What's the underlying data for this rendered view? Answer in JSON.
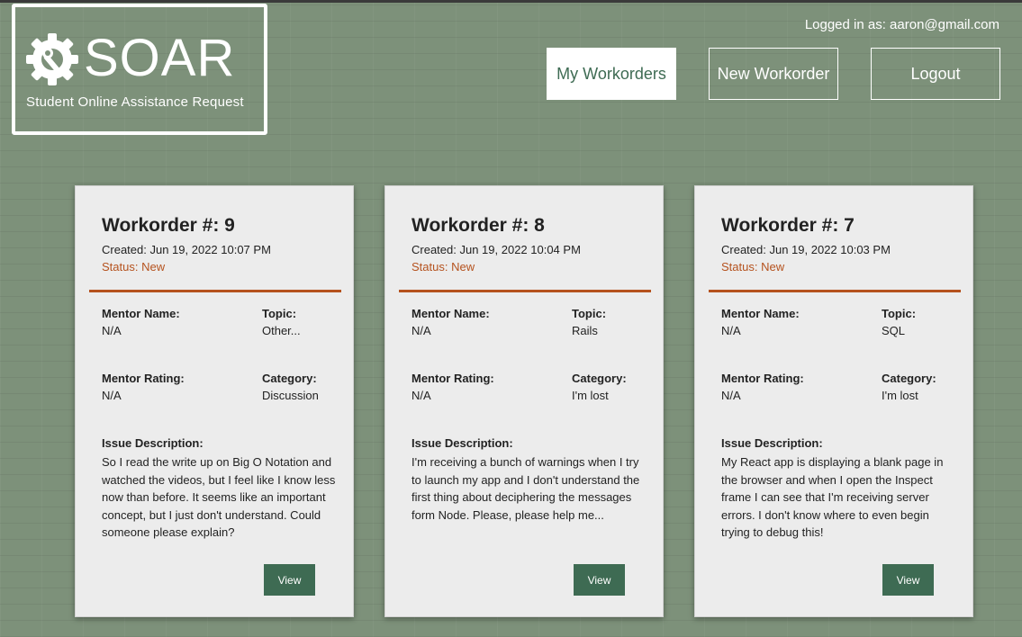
{
  "header": {
    "logo_text": "SOAR",
    "logo_subtitle": "Student Online Assistance Request",
    "logged_in_text": "Logged in as: aaron@gmail.com",
    "nav": {
      "my_workorders": "My Workorders",
      "new_workorder": "New Workorder",
      "logout": "Logout"
    }
  },
  "labels": {
    "mentor_name": "Mentor Name:",
    "topic": "Topic:",
    "mentor_rating": "Mentor Rating:",
    "category": "Category:",
    "issue_description": "Issue Description:",
    "view": "View"
  },
  "colors": {
    "accent": "#b5521e",
    "button_green": "#3e6b53",
    "background": "#7d917a"
  },
  "cards": [
    {
      "title": "Workorder #: 9",
      "created": "Created: Jun 19, 2022 10:07 PM",
      "status": "Status: New",
      "mentor_name": "N/A",
      "topic": "Other...",
      "mentor_rating": "N/A",
      "category": "Discussion",
      "description": "So I read the write up on Big O Notation and watched the videos, but I feel like I know less now than before. It seems like an important concept, but I just don't understand. Could someone please explain?"
    },
    {
      "title": "Workorder #: 8",
      "created": "Created: Jun 19, 2022 10:04 PM",
      "status": "Status: New",
      "mentor_name": "N/A",
      "topic": "Rails",
      "mentor_rating": "N/A",
      "category": "I'm lost",
      "description": "I'm receiving a bunch of warnings when I try to launch my app and I don't understand the first thing about deciphering the messages form Node. Please, please help me..."
    },
    {
      "title": "Workorder #: 7",
      "created": "Created: Jun 19, 2022 10:03 PM",
      "status": "Status: New",
      "mentor_name": "N/A",
      "topic": "SQL",
      "mentor_rating": "N/A",
      "category": "I'm lost",
      "description": "My React app is displaying a blank page in the browser and when I open the Inspect frame I can see that I'm receiving server errors. I don't know where to even begin trying to debug this!"
    }
  ]
}
